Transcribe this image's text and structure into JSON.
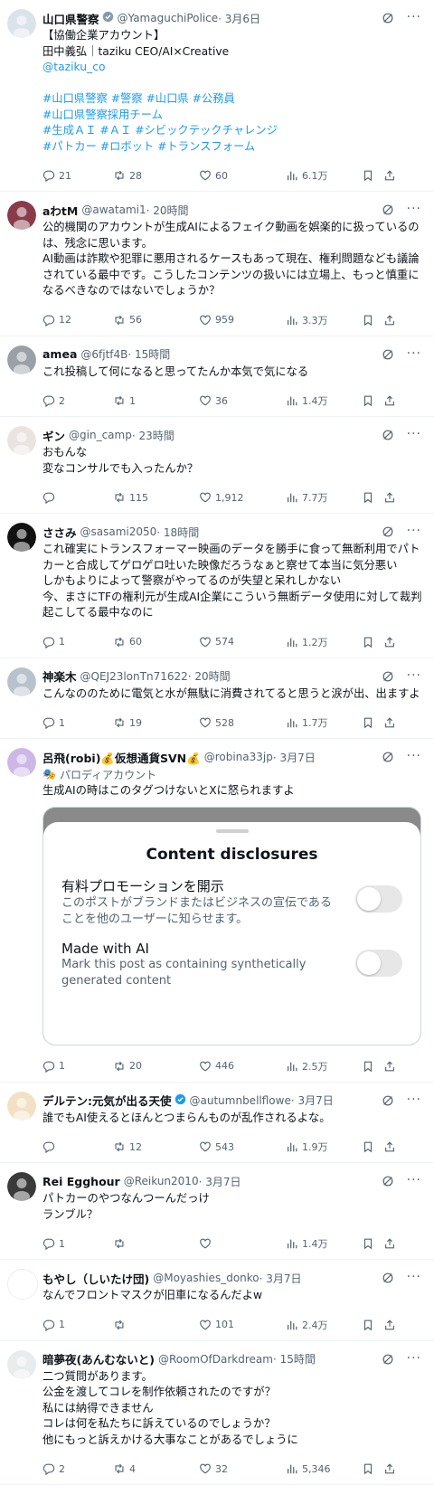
{
  "tweets": [
    {
      "name": "山口県警察",
      "handle": "@YamaguchiPolice",
      "time": "· 3月6日",
      "verified": "gray",
      "lines": [
        {
          "text": "【協働企業アカウント】",
          "link": false
        },
        {
          "text": "田中義弘｜taziku CEO/AI×Creative",
          "link": false
        },
        {
          "text": "@taziku_co",
          "link": true
        },
        {
          "text": " ",
          "link": false
        },
        {
          "text": "#山口県警察 #警察 #山口県 #公務員",
          "link": true
        },
        {
          "text": "#山口県警察採用チーム",
          "link": true
        },
        {
          "text": "#生成ＡＩ #ＡＩ #シビックテックチャレンジ",
          "link": true
        },
        {
          "text": "#パトカー #ロボット #トランスフォーム",
          "link": true
        }
      ],
      "replies": "21",
      "retweets": "28",
      "likes": "60",
      "views": "6.1万",
      "avatar_color": "#dbe3ea"
    },
    {
      "name": "aわtM",
      "handle": "@awatami1",
      "time": "· 20時間",
      "lines": [
        {
          "text": "公的機関のアカウントが生成AIによるフェイク動画を娯楽的に扱っているの",
          "link": false
        },
        {
          "text": "は、残念に思います。",
          "link": false
        },
        {
          "text": "AI動画は詐欺や犯罪に悪用されるケースもあって現在、権利問題なども議論",
          "link": false
        },
        {
          "text": "されている最中です。こうしたコンテンツの扱いには立場上、もっと慎重に",
          "link": false
        },
        {
          "text": "なるべきなのではないでしょうか？",
          "link": false
        }
      ],
      "replies": "12",
      "retweets": "56",
      "likes": "959",
      "views": "3.3万",
      "avatar_color": "#8a3b4a"
    },
    {
      "name": "amea",
      "handle": "@6fjtf4B",
      "time": "· 15時間",
      "lines": [
        {
          "text": "これ投稿して何になると思ってたんか本気で気になる",
          "link": false
        }
      ],
      "replies": "2",
      "retweets": "1",
      "likes": "36",
      "views": "1.4万",
      "avatar_color": "#9aa0a6"
    },
    {
      "name": "ギン",
      "handle": "@gin_camp",
      "time": "· 23時間",
      "lines": [
        {
          "text": "おもんな",
          "link": false
        },
        {
          "text": "変なコンサルでも入ったんか？",
          "link": false
        }
      ],
      "replies": "",
      "retweets": "115",
      "likes": "1,912",
      "views": "7.7万",
      "avatar_color": "#e9e4df"
    },
    {
      "name": "ささみ",
      "handle": "@sasami2050",
      "time": "· 18時間",
      "lines": [
        {
          "text": "これ確実にトランスフォーマー映画のデータを勝手に食って無断利用でパト",
          "link": false
        },
        {
          "text": "カーと合成してゲロゲロ吐いた映像だろうなぁと察せて本当に気分悪い",
          "link": false
        },
        {
          "text": "しかもよりによって警察がやってるのが失望と呆れしかない",
          "link": false
        },
        {
          "text": "今、まさにTFの権利元が生成AI企業にこういう無断データ使用に対して裁判",
          "link": false
        },
        {
          "text": "起こしてる最中なのに",
          "link": false
        }
      ],
      "replies": "1",
      "retweets": "60",
      "likes": "574",
      "views": "1.2万",
      "avatar_color": "#111111"
    },
    {
      "name": "神楽木",
      "handle": "@QEJ23lonTn71622",
      "time": "· 20時間",
      "lines": [
        {
          "text": "こんなののために電気と水が無駄に消費されてると思うと涙が出、出ますよ",
          "link": false
        }
      ],
      "replies": "1",
      "retweets": "19",
      "likes": "528",
      "views": "1.7万",
      "avatar_color": "#b8c2cc"
    },
    {
      "name": "呂飛(robi)💰仮想通貨SVN💰",
      "handle": "@robina33jp",
      "time": "· 3月7日",
      "parody": "パロディアカウント",
      "lines": [
        {
          "text": "生成AIの時はこのタグつけないとXに怒られますよ",
          "link": false
        }
      ],
      "embed": {
        "title": "Content disclosures",
        "options": [
          {
            "title": "有料プロモーションを開示",
            "desc": "このポストがブランドまたはビジネスの宣伝であることを他のユーザーに知らせます。",
            "on": false
          },
          {
            "title": "Made with AI",
            "desc": "Mark this post as containing synthetically generated content",
            "on": false
          }
        ]
      },
      "replies": "1",
      "retweets": "20",
      "likes": "446",
      "views": "2.5万",
      "avatar_color": "#cdb7e6"
    },
    {
      "name": "デルテン:元気が出る天使",
      "handle": "@autumnbellflowe",
      "time": "· 3月7日",
      "verified": "blue",
      "lines": [
        {
          "text": "誰でもAI使えるとほんとつまらんものが乱作されるよな。",
          "link": false
        }
      ],
      "replies": "",
      "retweets": "12",
      "likes": "543",
      "views": "1.9万",
      "avatar_color": "#f2e1c4"
    },
    {
      "name": "Rei Egghour",
      "handle": "@Reikun2010",
      "time": "· 3月7日",
      "lines": [
        {
          "text": "パトカーのやつなんつーんだっけ",
          "link": false
        },
        {
          "text": "ランブル？",
          "link": false
        }
      ],
      "replies": "1",
      "retweets": "",
      "likes": "",
      "views": "1.4万",
      "avatar_color": "#3a3a3a"
    },
    {
      "name": "もやし（しいたけ団)",
      "handle": "@Moyashies_donko",
      "time": "· 3月7日",
      "lines": [
        {
          "text": "なんでフロントマスクが旧車になるんだよw",
          "link": false
        }
      ],
      "replies": "1",
      "retweets": "",
      "likes": "101",
      "views": "2.4万",
      "avatar_color": "#ffffff"
    },
    {
      "name": "暗夢夜(あんむないと)",
      "handle": "@RoomOfDarkdream",
      "time": "· 15時間",
      "lines": [
        {
          "text": "二つ質問があります。",
          "link": false
        },
        {
          "text": "公金を渡してコレを制作依頼されたのですが？",
          "link": false
        },
        {
          "text": "私には納得できません",
          "link": false
        },
        {
          "text": "コレは何を私たちに訴えているのでしょうか？",
          "link": false
        },
        {
          "text": "他にもっと訴えかける大事なことがあるでしょうに",
          "link": false
        }
      ],
      "replies": "2",
      "retweets": "4",
      "likes": "32",
      "views": "5,346",
      "avatar_color": "#e8ecef"
    }
  ]
}
